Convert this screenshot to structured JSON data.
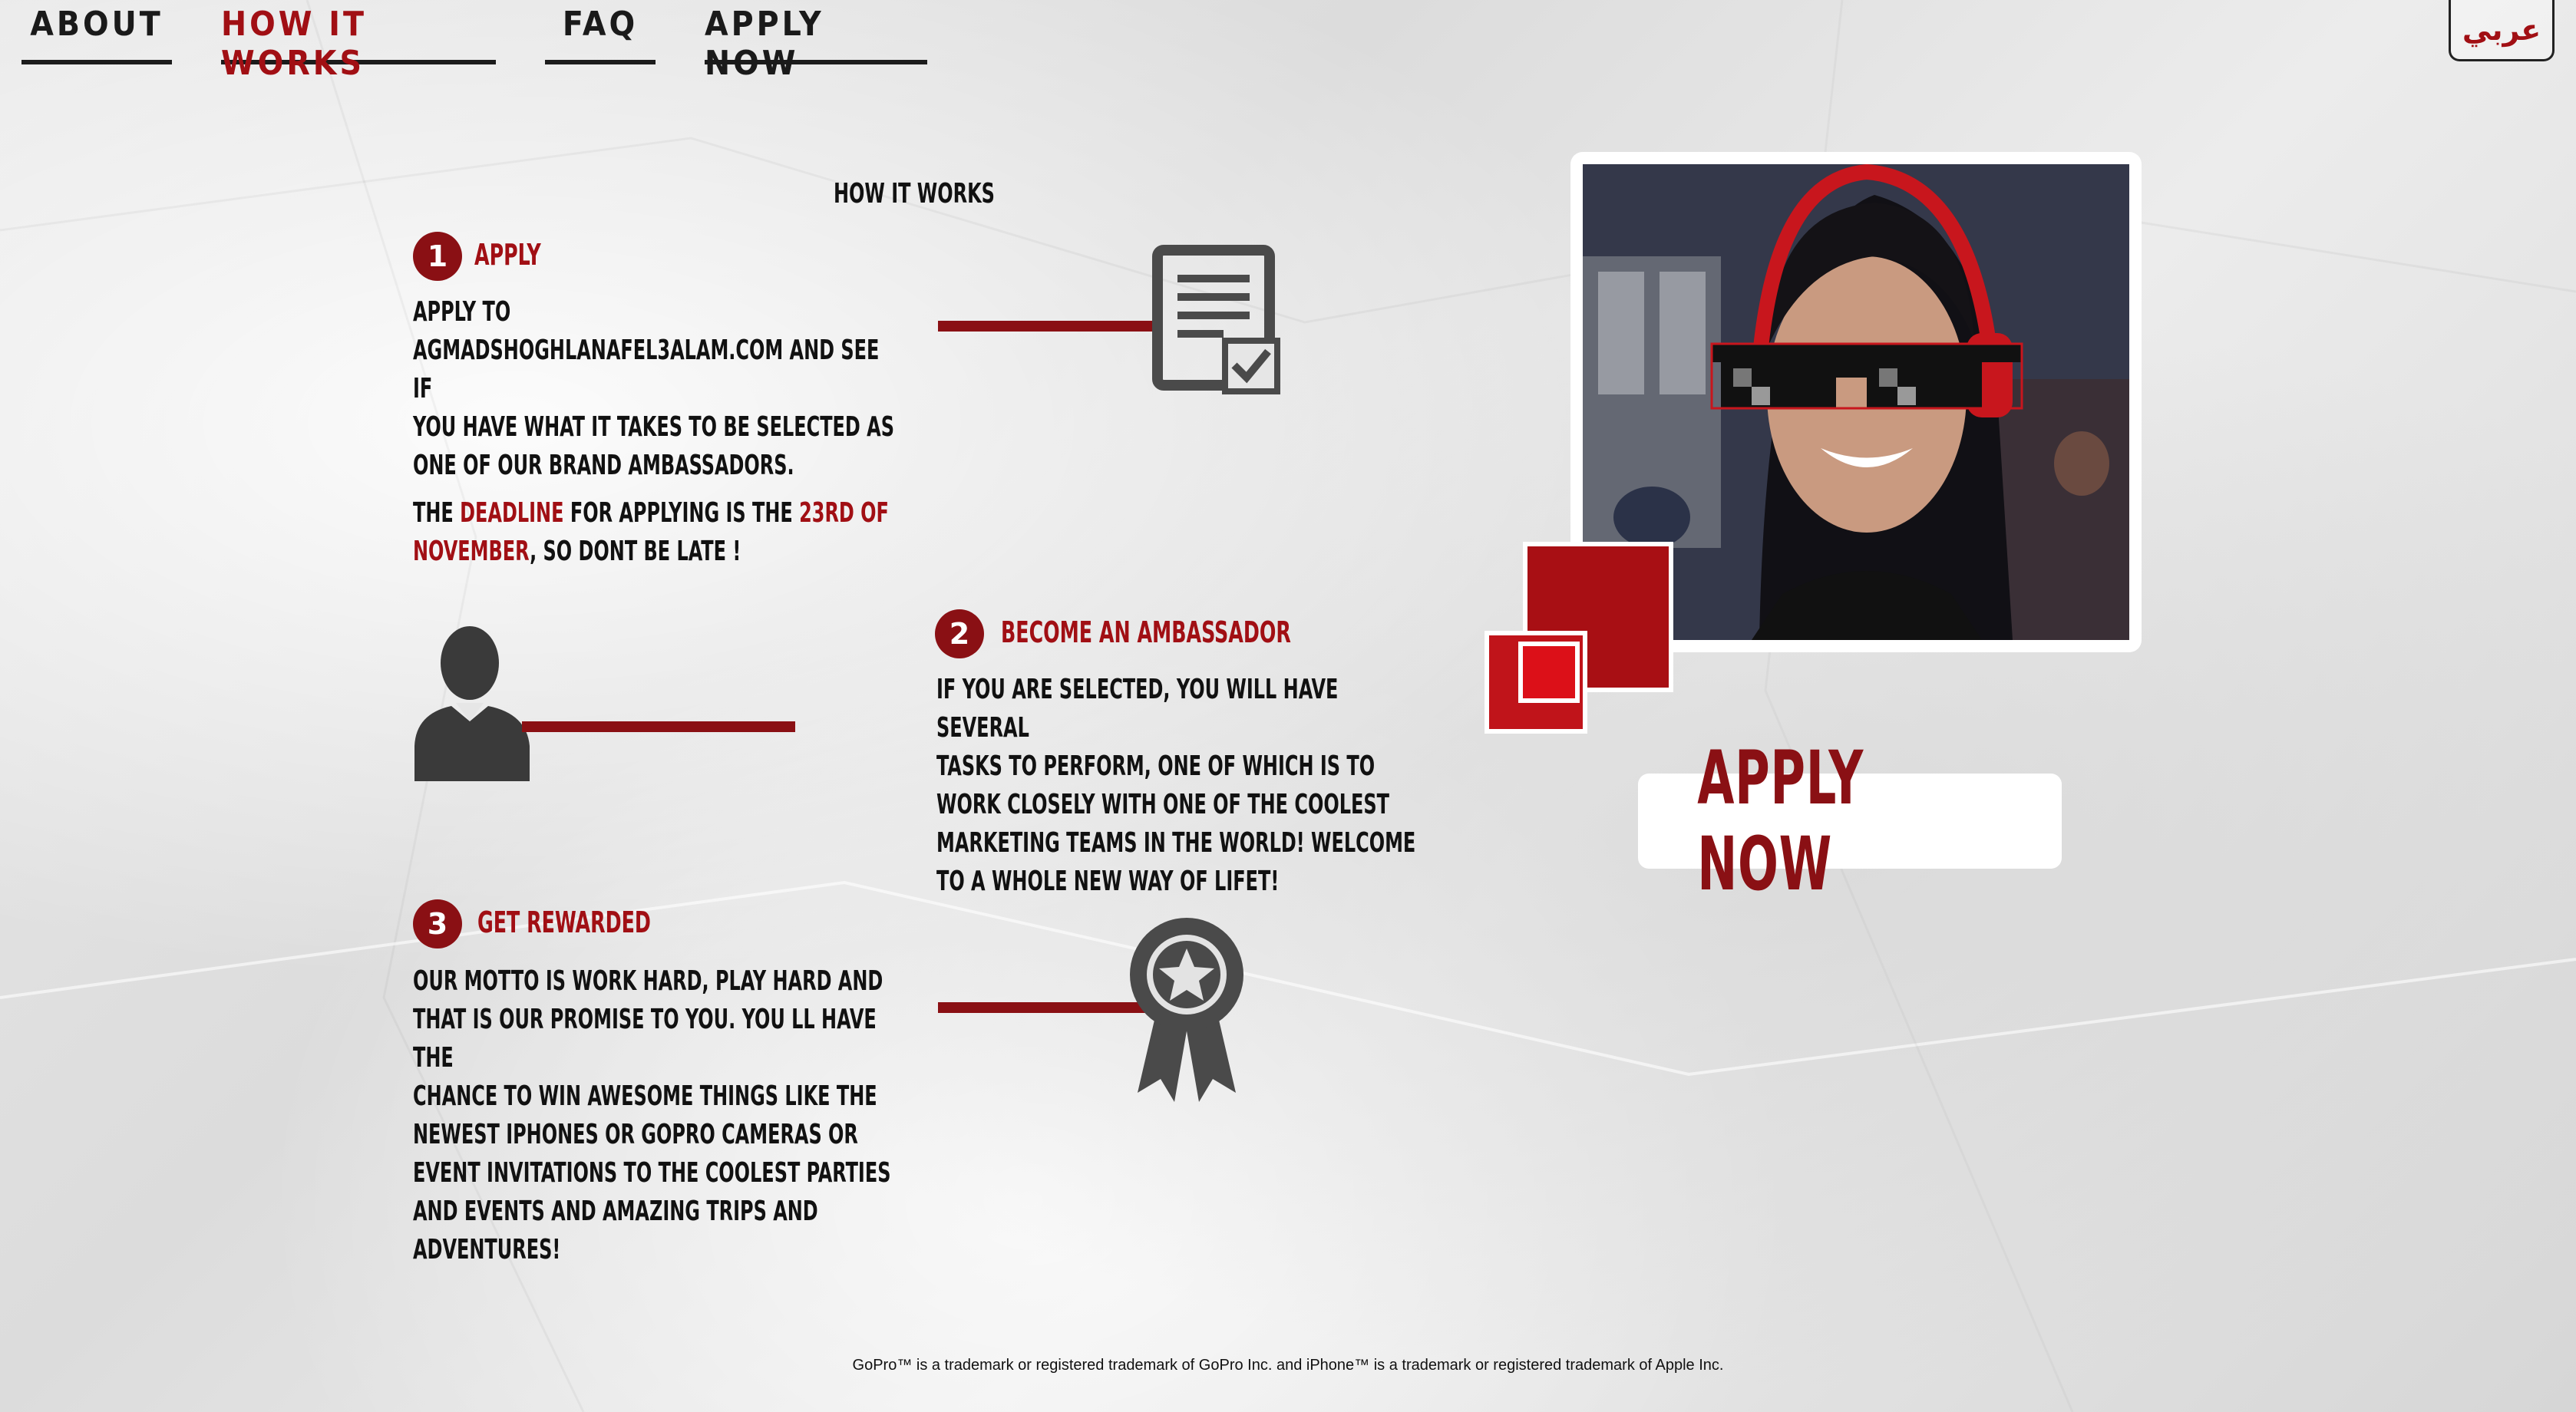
{
  "nav": {
    "items": [
      {
        "label": "ABOUT"
      },
      {
        "label": "HOW IT WORKS"
      },
      {
        "label": "FAQ"
      },
      {
        "label": "APPLY NOW"
      }
    ],
    "active_index": 1,
    "language_toggle": "عربي"
  },
  "section": {
    "title": "HOW IT WORKS"
  },
  "steps": [
    {
      "number": "1",
      "heading": "APPLY",
      "body_lines": [
        "APPLY TO",
        "AGMADSHOGHLANAFEL3ALAM.COM AND SEE IF",
        "YOU HAVE WHAT IT TAKES TO BE SELECTED AS",
        "ONE OF OUR BRAND AMBASSADORS."
      ],
      "deadline": {
        "prefix": "THE ",
        "highlight1": "DEADLINE",
        "middle": " FOR APPLYING IS THE ",
        "highlight2": "23RD OF",
        "highlight3": "NOVEMBER",
        "suffix": ", SO DONT BE LATE !"
      },
      "icon": "document-check-icon"
    },
    {
      "number": "2",
      "heading": "BECOME AN AMBASSADOR",
      "body_lines": [
        "IF YOU ARE SELECTED, YOU WILL HAVE SEVERAL",
        "TASKS TO PERFORM, ONE OF WHICH IS TO",
        "WORK CLOSELY WITH ONE OF THE COOLEST",
        "MARKETING TEAMS IN THE WORLD! WELCOME",
        "TO A WHOLE NEW WAY OF LIFET!"
      ],
      "icon": "person-silhouette-icon"
    },
    {
      "number": "3",
      "heading": "GET REWARDED",
      "body_lines": [
        "OUR MOTTO IS WORK HARD, PLAY HARD   AND",
        "THAT IS OUR PROMISE TO YOU. YOU LL HAVE THE",
        "CHANCE TO WIN AWESOME THINGS LIKE THE",
        "NEWEST IPHONES OR GOPRO CAMERAS OR",
        "EVENT INVITATIONS TO THE COOLEST PARTIES",
        "AND EVENTS AND AMAZING TRIPS AND",
        "ADVENTURES!"
      ],
      "icon": "award-ribbon-icon"
    }
  ],
  "cta": {
    "label": "APPLY NOW"
  },
  "footer": {
    "text": "GoPro™ is a trademark or registered trademark of GoPro Inc. and iPhone™  is a trademark or registered trademark of Apple Inc."
  },
  "colors": {
    "accent_red": "#a10f14",
    "dark_red": "#8a1014",
    "text_dark": "#111111",
    "icon_gray": "#4a4a4a"
  }
}
